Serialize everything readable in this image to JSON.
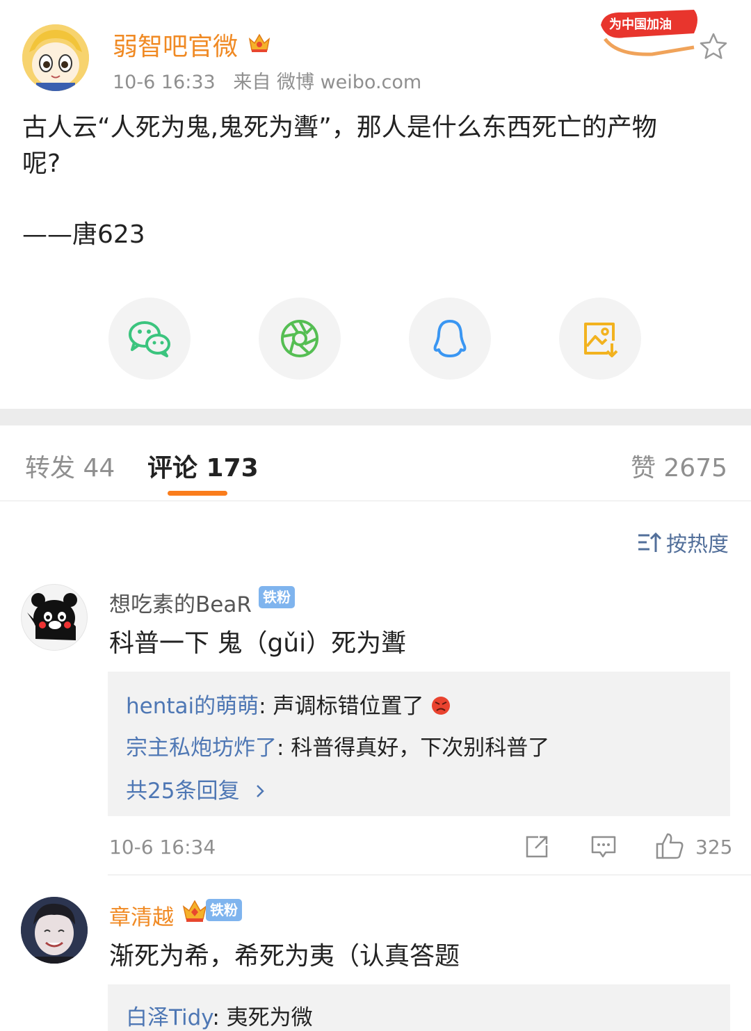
{
  "post": {
    "author": "弱智吧官微",
    "time": "10-6 16:33",
    "source_prefix": "来自",
    "source": "微博 weibo.com",
    "badge_text": "为中国加油",
    "body_line1": "古人云“人死为鬼,鬼死为聻”，那人是什么东西死亡的产物",
    "body_line2": "呢?",
    "signature": "——唐623"
  },
  "share": [
    "wechat-icon",
    "moments-icon",
    "qq-icon",
    "save-image-icon"
  ],
  "tabs": {
    "repost": "转发 44",
    "comments": "评论 173",
    "likes": "赞 2675"
  },
  "sort": {
    "label": "按热度"
  },
  "comments": [
    {
      "user": "想吃素的BeaR",
      "fan_badge": "铁粉",
      "text": "科普一下 鬼（gǔi）死为聻",
      "replies": [
        {
          "user": "hentai的萌萌",
          "text": ": 声调标错位置了"
        },
        {
          "user": "宗主私炮坊炸了",
          "text": ": 科普得真好，下次别科普了"
        }
      ],
      "more_replies": "共25条回复",
      "time": "10-6 16:34",
      "likes": "325"
    },
    {
      "user": "章清越",
      "fan_badge": "铁粉",
      "text": "渐死为希，希死为夷（认真答题",
      "replies": [
        {
          "user": "白泽Tidy",
          "text": ": 夷死为微"
        }
      ]
    }
  ],
  "colors": {
    "accent_orange": "#fa7d1c",
    "author_orange": "#f08a24",
    "link_blue": "#4e77b4",
    "gray_text": "#8f8f8f"
  }
}
